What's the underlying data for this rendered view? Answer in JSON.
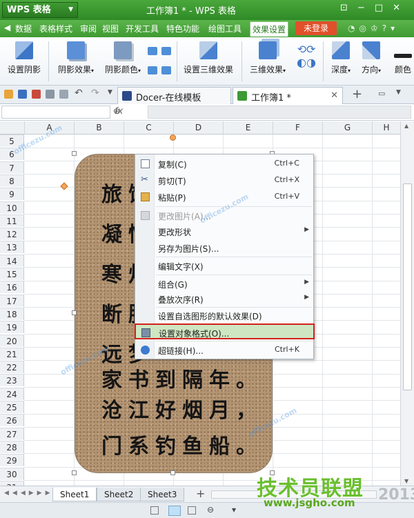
{
  "app": {
    "name": "WPS 表格",
    "window_title": "工作簿1 * - WPS 表格"
  },
  "menu": {
    "items": [
      "数据",
      "表格样式",
      "审阅",
      "视图",
      "开发工具",
      "特色功能",
      "绘图工具",
      "效果设置"
    ],
    "active_index": 7,
    "login_label": "未登录"
  },
  "ribbon": {
    "buttons": [
      "设置阴影",
      "阴影效果",
      "阴影颜色",
      "设置三维效果",
      "三维效果",
      "深度",
      "方向",
      "颜色"
    ]
  },
  "tabs": {
    "doc_tabs": [
      "Docer-在线模板",
      "工作簿1 *"
    ],
    "add_label": "+"
  },
  "formula": {
    "fx": "fx"
  },
  "grid": {
    "columns": [
      "A",
      "B",
      "C",
      "D",
      "E",
      "F",
      "G",
      "H"
    ],
    "rows": [
      "5",
      "6",
      "7",
      "8",
      "9",
      "10",
      "11",
      "12",
      "13",
      "14",
      "15",
      "16",
      "17",
      "18",
      "19",
      "20",
      "21",
      "22",
      "23",
      "24",
      "25",
      "26",
      "27",
      "28",
      "29",
      "30",
      "31"
    ]
  },
  "poem": {
    "lines": [
      "旅馆",
      "凝情",
      "寒灯",
      "断肠",
      "远梦",
      "家书到隔年。",
      "沧江好烟月，",
      "门系钓鱼船。"
    ]
  },
  "context_menu": {
    "items": [
      {
        "label": "复制(C)",
        "shortcut": "Ctrl+C",
        "icon": "copy-icon"
      },
      {
        "label": "剪切(T)",
        "shortcut": "Ctrl+X",
        "icon": "scissors-icon"
      },
      {
        "label": "粘贴(P)",
        "shortcut": "Ctrl+V",
        "icon": "paste-icon"
      },
      {
        "label": "更改图片(A)...",
        "shortcut": "",
        "icon": "picture-icon",
        "disabled": true
      },
      {
        "label": "更改形状",
        "shortcut": "",
        "submenu": true
      },
      {
        "label": "另存为图片(S)...",
        "shortcut": ""
      },
      {
        "label": "编辑文字(X)",
        "shortcut": ""
      },
      {
        "label": "组合(G)",
        "shortcut": "",
        "submenu": true
      },
      {
        "label": "叠放次序(R)",
        "shortcut": "",
        "submenu": true
      },
      {
        "label": "设置自选图形的默认效果(D)",
        "shortcut": ""
      },
      {
        "label": "设置对象格式(O)...",
        "shortcut": "",
        "icon": "format-object-icon",
        "highlighted": true
      },
      {
        "label": "超链接(H)...",
        "shortcut": "Ctrl+K",
        "icon": "hyperlink-icon"
      }
    ]
  },
  "sheets": {
    "names": [
      "Sheet1",
      "Sheet2",
      "Sheet3"
    ],
    "active_index": 0,
    "add_label": "+"
  },
  "watermark": {
    "site": "officezu.com",
    "brand": "技术员联盟",
    "url": "www.jsgho.com",
    "year": "2013"
  },
  "colors": {
    "title_green": "#2f8a26",
    "accent_orange": "#e0502a",
    "highlight_red": "#d4201e",
    "menu_highlight": "#cfe6c2"
  }
}
